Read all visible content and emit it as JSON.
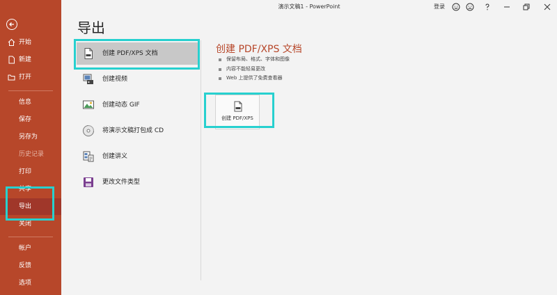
{
  "window": {
    "title": "演示文稿1  -  PowerPoint",
    "login_label": "登录"
  },
  "sidebar": {
    "items": [
      {
        "label": "开始",
        "icon": "home-icon"
      },
      {
        "label": "新建",
        "icon": "new-file-icon"
      },
      {
        "label": "打开",
        "icon": "folder-open-icon"
      },
      {
        "label": "信息"
      },
      {
        "label": "保存"
      },
      {
        "label": "另存为"
      },
      {
        "label": "历史记录"
      },
      {
        "label": "打印"
      },
      {
        "label": "共享"
      },
      {
        "label": "导出"
      },
      {
        "label": "关闭"
      },
      {
        "label": "帐户"
      },
      {
        "label": "反馈"
      },
      {
        "label": "选项"
      }
    ]
  },
  "main": {
    "title": "导出",
    "options": [
      {
        "label": "创建 PDF/XPS 文档",
        "icon": "pdf-document-icon"
      },
      {
        "label": "创建视频",
        "icon": "video-icon"
      },
      {
        "label": "创建动态 GIF",
        "icon": "gif-icon"
      },
      {
        "label": "将演示文稿打包成 CD",
        "icon": "cd-icon"
      },
      {
        "label": "创建讲义",
        "icon": "handout-icon"
      },
      {
        "label": "更改文件类型",
        "icon": "save-filetype-icon"
      }
    ],
    "detail": {
      "title": "创建 PDF/XPS 文档",
      "bullets": [
        "保留布局、格式、字体和图像",
        "内容不能轻易更改",
        "Web 上提供了免费查看器"
      ],
      "button_label": "创建 PDF/XPS"
    }
  },
  "colors": {
    "accent": "#b7472a",
    "highlight": "#27d0cf"
  }
}
